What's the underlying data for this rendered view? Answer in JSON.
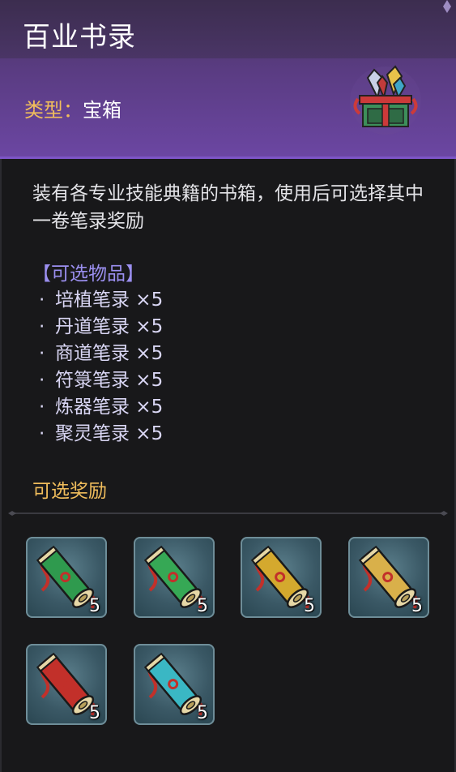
{
  "header": {
    "title": "百业书录",
    "type_label": "类型：",
    "type_value": "宝箱",
    "icon": "treasure-chest-icon"
  },
  "description": "装有各专业技能典籍的书箱，使用后可选择其中一卷笔录奖励",
  "options": {
    "title": "【可选物品】",
    "items": [
      {
        "bullet": "·",
        "text": "培植笔录 ×5"
      },
      {
        "bullet": "·",
        "text": "丹道笔录 ×5"
      },
      {
        "bullet": "·",
        "text": "商道笔录 ×5"
      },
      {
        "bullet": "·",
        "text": "符箓笔录 ×5"
      },
      {
        "bullet": "·",
        "text": "炼器笔录 ×5"
      },
      {
        "bullet": "·",
        "text": "聚灵笔录 ×5"
      }
    ]
  },
  "rewards": {
    "title": "可选奖励",
    "items": [
      {
        "icon": "scroll-green-icon",
        "count": "5",
        "color": "#2f9a4e"
      },
      {
        "icon": "scroll-green-icon",
        "count": "5",
        "color": "#36a855"
      },
      {
        "icon": "scroll-gold-icon",
        "count": "5",
        "color": "#d4a92e"
      },
      {
        "icon": "scroll-gold-icon",
        "count": "5",
        "color": "#d9b04a"
      },
      {
        "icon": "scroll-red-icon",
        "count": "5",
        "color": "#c2302a"
      },
      {
        "icon": "scroll-cyan-icon",
        "count": "5",
        "color": "#3ab7c4"
      }
    ]
  },
  "colors": {
    "accent_gold": "#f0bd5c",
    "accent_purple": "#9b8ff0",
    "header_purple": "#5a3c82"
  }
}
